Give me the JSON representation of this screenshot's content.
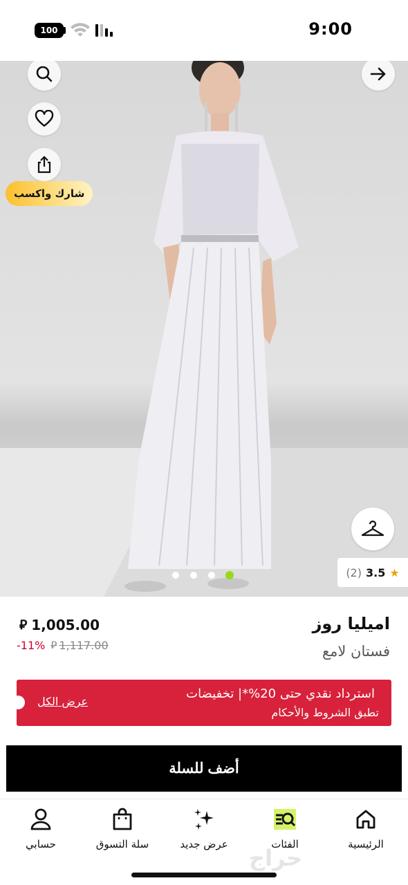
{
  "status_bar": {
    "time": "9:00",
    "battery": "100"
  },
  "gallery": {
    "share_earn_label": "شارك واكسب",
    "rating_value": "3.5",
    "rating_count": "(2)",
    "image_count": 4,
    "active_image_index": 3
  },
  "product": {
    "brand": "اميليا روز",
    "name": "فستان لامع",
    "price": "1,005.00",
    "old_price": "1,117.00",
    "discount": "-11%",
    "currency_icon": "riyal-icon"
  },
  "promo": {
    "title": "استرداد نقدي حتى 20%*| تخفيضات",
    "terms": "تطبق الشروط والأحكام",
    "view_all": "عرض الكل",
    "color": "#d8213a"
  },
  "cta": {
    "add_to_cart": "أضف للسلة"
  },
  "bottom_nav": {
    "items": [
      {
        "label": "الرئيسية",
        "icon": "home-icon"
      },
      {
        "label": "الفئات",
        "icon": "categories-icon"
      },
      {
        "label": "عرض جديد",
        "icon": "sparkles-icon"
      },
      {
        "label": "سلة التسوق",
        "icon": "shopping-bag-icon"
      },
      {
        "label": "حسابي",
        "icon": "user-icon"
      }
    ]
  }
}
